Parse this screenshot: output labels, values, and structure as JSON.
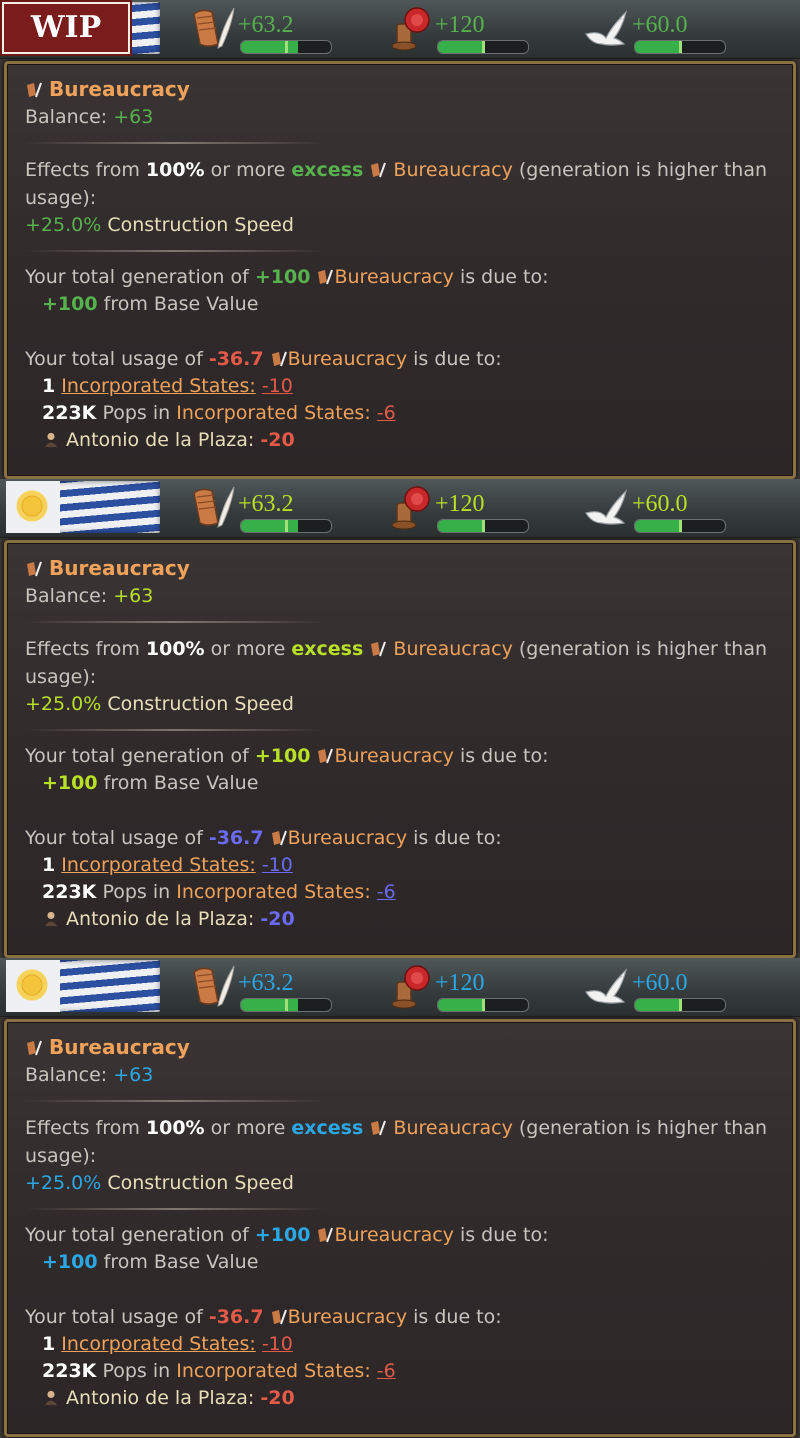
{
  "badge": "WIP",
  "panels": [
    {
      "colors": {
        "pos": "#56b24c",
        "neg": "#e35a48"
      },
      "bureaucracy": {
        "value": "+63.2",
        "fill": 0.63
      },
      "authority": {
        "value": "+120",
        "fill": 0.5
      },
      "influence": {
        "value": "+60.0",
        "fill": 0.5
      },
      "title": "Bureaucracy",
      "balance_label": "Balance:",
      "balance_value": "+63",
      "effects": {
        "prefix": "Effects from",
        "pct": "100%",
        "mid": "or more",
        "excess": "excess",
        "res": "Bureaucracy",
        "suffix": "(generation is higher than usage):"
      },
      "effect_value": "+25.0%",
      "effect_label": "Construction Speed",
      "gen_prefix": "Your total generation of",
      "gen_value": "+100",
      "gen_res": "Bureaucracy",
      "gen_suffix": "is due to:",
      "base_value": "+100",
      "base_label": "from Base Value",
      "usage_prefix": "Your total usage of",
      "usage_value": "-36.7",
      "usage_res": "Bureaucracy",
      "usage_suffix": "is due to:",
      "inc_count": "1",
      "inc_label": "Incorporated States:",
      "inc_value": "-10",
      "pops_count": "223K",
      "pops_mid": "Pops in",
      "pops_label": "Incorporated States:",
      "pops_value": "-6",
      "person_name": "Antonio de la Plaza:",
      "person_value": "-20"
    },
    {
      "colors": {
        "pos": "#b8e024",
        "neg": "#6a6af2"
      },
      "bureaucracy": {
        "value": "+63.2",
        "fill": 0.63
      },
      "authority": {
        "value": "+120",
        "fill": 0.5
      },
      "influence": {
        "value": "+60.0",
        "fill": 0.5
      },
      "title": "Bureaucracy",
      "balance_label": "Balance:",
      "balance_value": "+63",
      "effects": {
        "prefix": "Effects from",
        "pct": "100%",
        "mid": "or more",
        "excess": "excess",
        "res": "Bureaucracy",
        "suffix": "(generation is higher than usage):"
      },
      "effect_value": "+25.0%",
      "effect_label": "Construction Speed",
      "gen_prefix": "Your total generation of",
      "gen_value": "+100",
      "gen_res": "Bureaucracy",
      "gen_suffix": "is due to:",
      "base_value": "+100",
      "base_label": "from Base Value",
      "usage_prefix": "Your total usage of",
      "usage_value": "-36.7",
      "usage_res": "Bureaucracy",
      "usage_suffix": "is due to:",
      "inc_count": "1",
      "inc_label": "Incorporated States:",
      "inc_value": "-10",
      "pops_count": "223K",
      "pops_mid": "Pops in",
      "pops_label": "Incorporated States:",
      "pops_value": "-6",
      "person_name": "Antonio de la Plaza:",
      "person_value": "-20"
    },
    {
      "colors": {
        "pos": "#2aa8e6",
        "neg": "#e35a48"
      },
      "bureaucracy": {
        "value": "+63.2",
        "fill": 0.63
      },
      "authority": {
        "value": "+120",
        "fill": 0.5
      },
      "influence": {
        "value": "+60.0",
        "fill": 0.5
      },
      "title": "Bureaucracy",
      "balance_label": "Balance:",
      "balance_value": "+63",
      "effects": {
        "prefix": "Effects from",
        "pct": "100%",
        "mid": "or more",
        "excess": "excess",
        "res": "Bureaucracy",
        "suffix": "(generation is higher than usage):"
      },
      "effect_value": "+25.0%",
      "effect_label": "Construction Speed",
      "gen_prefix": "Your total generation of",
      "gen_value": "+100",
      "gen_res": "Bureaucracy",
      "gen_suffix": "is due to:",
      "base_value": "+100",
      "base_label": "from Base Value",
      "usage_prefix": "Your total usage of",
      "usage_value": "-36.7",
      "usage_res": "Bureaucracy",
      "usage_suffix": "is due to:",
      "inc_count": "1",
      "inc_label": "Incorporated States:",
      "inc_value": "-10",
      "pops_count": "223K",
      "pops_mid": "Pops in",
      "pops_label": "Incorporated States:",
      "pops_value": "-6",
      "person_name": "Antonio de la Plaza:",
      "person_value": "-20"
    }
  ]
}
